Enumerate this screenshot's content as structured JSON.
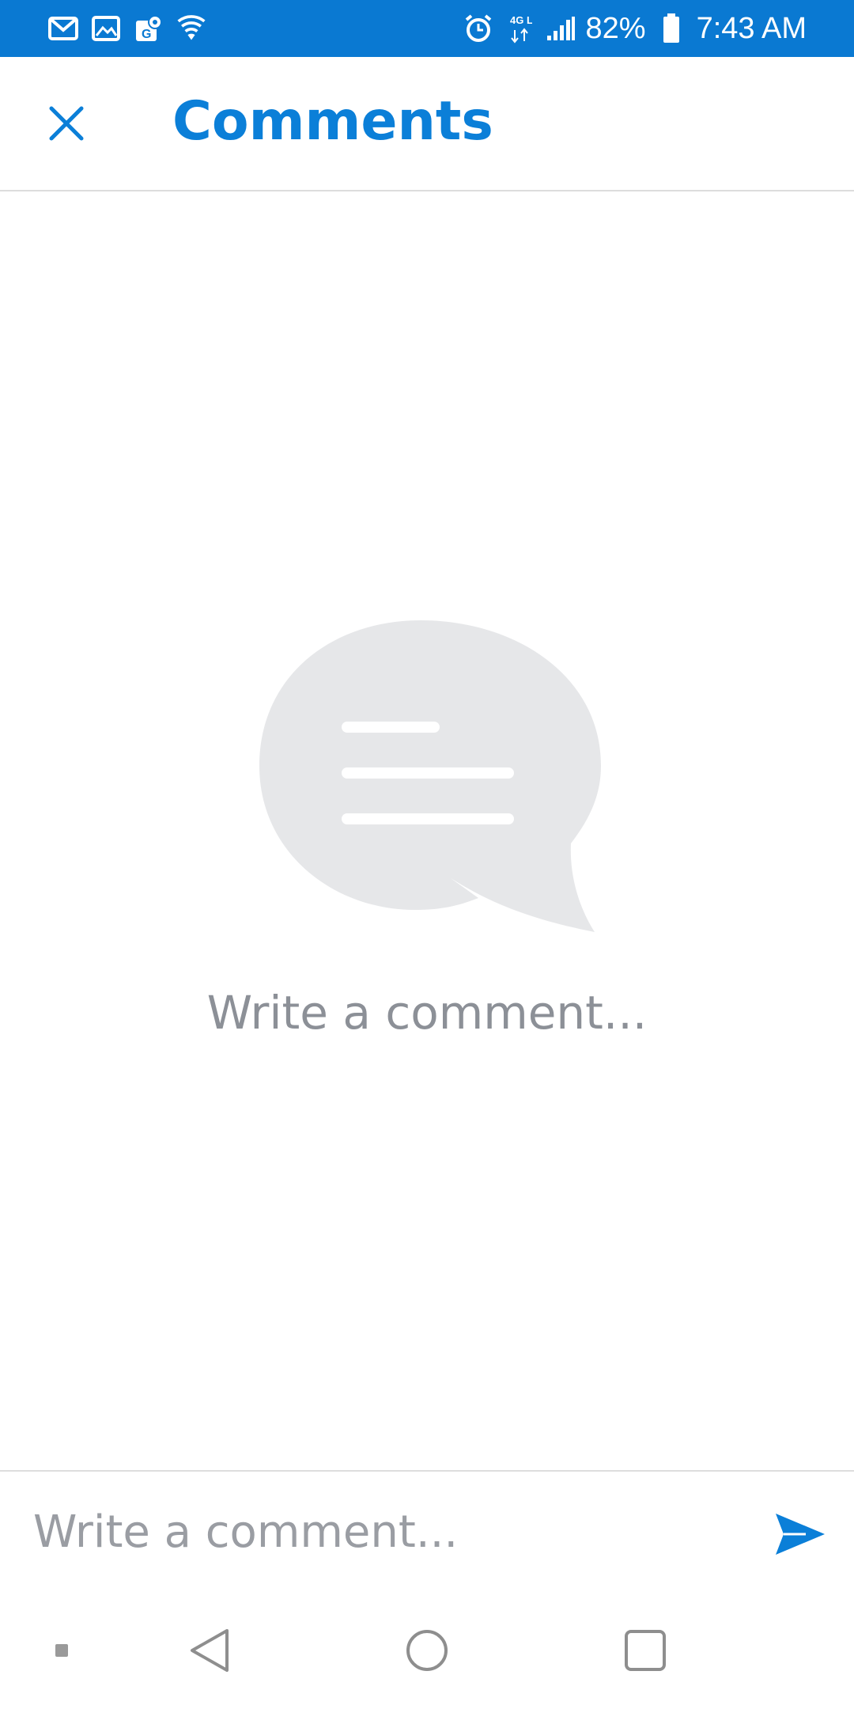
{
  "status_bar": {
    "background": "#0a79d2",
    "left_icons": [
      "gmail-icon",
      "gallery-icon",
      "maps-icon",
      "wifi-icon"
    ],
    "right_icons": [
      "alarm-icon",
      "lte-icon",
      "signal-icon",
      "battery-icon"
    ],
    "network_label": "4G LTE",
    "battery": "82%",
    "time": "7:43 AM"
  },
  "header": {
    "title": "Comments",
    "close_icon": "close-icon",
    "accent": "#0b7fd8"
  },
  "empty_state": {
    "icon": "speech-bubble-icon",
    "message": "Write a comment..."
  },
  "composer": {
    "placeholder": "Write a comment...",
    "value": "",
    "send_icon": "send-icon"
  },
  "nav_bar": {
    "buttons": [
      "recent-dot-icon",
      "back-icon",
      "home-icon",
      "overview-icon"
    ]
  }
}
